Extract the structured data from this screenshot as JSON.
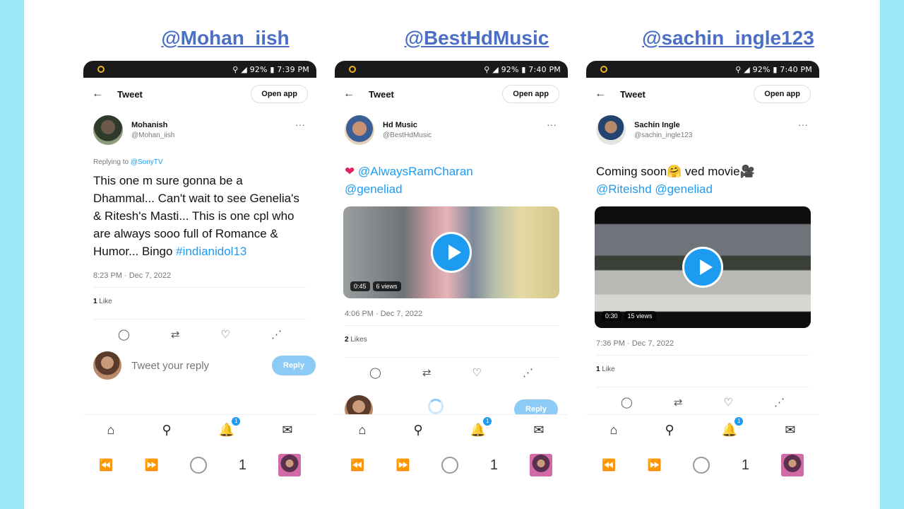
{
  "colors": {
    "accent": "#1d9bf0",
    "handle": "#4a6fc4",
    "frame": "#9be8fb"
  },
  "handles": [
    "@Mohan_iish",
    "@BestHdMusic",
    "@sachin_ingle123"
  ],
  "phones": [
    {
      "status": {
        "right": "⚲ ◢ 92% ▮ 7:39 PM"
      },
      "topbar": {
        "back": "←",
        "title": "Tweet",
        "open_app": "Open app"
      },
      "author": {
        "name": "Mohanish",
        "username": "@Mohan_iish",
        "more": "···"
      },
      "replying": {
        "prefix": "Replying to ",
        "handle": "@SonyTV"
      },
      "text": {
        "body": "This one m sure gonna be a Dhammal... Can't wait to see Genelia's & Ritesh's Masti... This is one cpl who are always sooo full of Romance &  Humor... Bingo ",
        "hashtag": "#indianidol13"
      },
      "timestamp": "8:23 PM · Dec 7, 2022",
      "likes": {
        "count": "1",
        "label": "Like"
      },
      "reply": {
        "placeholder": "Tweet your reply",
        "button": "Reply"
      }
    },
    {
      "status": {
        "right": "⚲ ◢ 92% ▮ 7:40 PM"
      },
      "topbar": {
        "back": "←",
        "title": "Tweet",
        "open_app": "Open app"
      },
      "author": {
        "name": "Hd Music",
        "username": "@BestHdMusic",
        "more": "···"
      },
      "text": {
        "emoji": "❤",
        "mention1": "@AlwaysRamCharan",
        "mention2": "@geneliad"
      },
      "media": {
        "duration": "0:45",
        "views": "6 views"
      },
      "timestamp": "4:06 PM · Dec 7, 2022",
      "likes": {
        "count": "2",
        "label": "Likes"
      },
      "reply": {
        "button": "Reply"
      }
    },
    {
      "status": {
        "right": "⚲ ◢ 92% ▮ 7:40 PM"
      },
      "topbar": {
        "back": "←",
        "title": "Tweet",
        "open_app": "Open app"
      },
      "author": {
        "name": "Sachin Ingle",
        "username": "@sachin_ingle123",
        "more": "···"
      },
      "text": {
        "body": "Coming soon🤗 ved movie🎥",
        "mention1": "@Riteishd",
        "mention2": "@geneliad"
      },
      "media": {
        "duration": "0:30",
        "views": "15 views"
      },
      "timestamp": "7:36 PM · Dec 7, 2022",
      "likes": {
        "count": "1",
        "label": "Like"
      }
    }
  ],
  "icons": {
    "reply": "◯",
    "retweet": "⇄",
    "like": "♡",
    "share": "⋰",
    "home": "⌂",
    "search": "⚲",
    "bell": "🔔",
    "mail": "✉",
    "rewind": "⏪",
    "forward": "⏩"
  },
  "notif_badge": "1",
  "sysnav": {
    "counter": "1"
  }
}
